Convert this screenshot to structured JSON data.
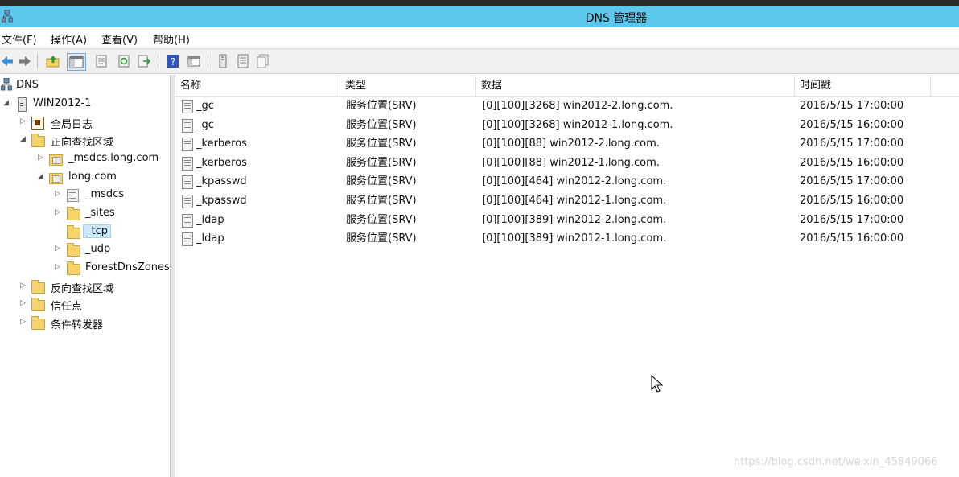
{
  "window": {
    "title": "DNS 管理器"
  },
  "menu": [
    {
      "label": "文件(F)"
    },
    {
      "label": "操作(A)"
    },
    {
      "label": "查看(V)"
    },
    {
      "label": "帮助(H)"
    }
  ],
  "toolbar": {
    "buttons": [
      "back-icon",
      "forward-icon",
      "up-icon",
      "show-hide-tree-icon",
      "properties-icon",
      "refresh-icon",
      "export-list-icon",
      "help-icon",
      "mmc-icon",
      "server-icon",
      "record-icon",
      "copy-record-icon"
    ]
  },
  "tree": {
    "root": "DNS",
    "server": "WIN2012-1",
    "global_logs": "全局日志",
    "forward_zones": "正向查找区域",
    "msdcs_zone": "_msdcs.long.com",
    "long_zone": "long.com",
    "msdcs_child": "_msdcs",
    "sites": "_sites",
    "tcp": "_tcp",
    "udp": "_udp",
    "forest": "ForestDnsZones",
    "reverse_zones": "反向查找区域",
    "trust_points": "信任点",
    "cond_forwarders": "条件转发器"
  },
  "table": {
    "columns": [
      "名称",
      "类型",
      "数据",
      "时间戳"
    ],
    "rows": [
      {
        "name": "_gc",
        "type": "服务位置(SRV)",
        "data": "[0][100][3268] win2012-2.long.com.",
        "timestamp": "2016/5/15 17:00:00"
      },
      {
        "name": "_gc",
        "type": "服务位置(SRV)",
        "data": "[0][100][3268] win2012-1.long.com.",
        "timestamp": "2016/5/15 16:00:00"
      },
      {
        "name": "_kerberos",
        "type": "服务位置(SRV)",
        "data": "[0][100][88] win2012-2.long.com.",
        "timestamp": "2016/5/15 17:00:00"
      },
      {
        "name": "_kerberos",
        "type": "服务位置(SRV)",
        "data": "[0][100][88] win2012-1.long.com.",
        "timestamp": "2016/5/15 16:00:00"
      },
      {
        "name": "_kpasswd",
        "type": "服务位置(SRV)",
        "data": "[0][100][464] win2012-2.long.com.",
        "timestamp": "2016/5/15 17:00:00"
      },
      {
        "name": "_kpasswd",
        "type": "服务位置(SRV)",
        "data": "[0][100][464] win2012-1.long.com.",
        "timestamp": "2016/5/15 16:00:00"
      },
      {
        "name": "_ldap",
        "type": "服务位置(SRV)",
        "data": "[0][100][389] win2012-2.long.com.",
        "timestamp": "2016/5/15 17:00:00"
      },
      {
        "name": "_ldap",
        "type": "服务位置(SRV)",
        "data": "[0][100][389] win2012-1.long.com.",
        "timestamp": "2016/5/15 16:00:00"
      }
    ]
  },
  "watermark": "https://blog.csdn.net/weixin_45849066",
  "colors": {
    "titlebar": "#5bc7ec",
    "selection": "#cce8ff",
    "folder": "#f5d36b"
  }
}
